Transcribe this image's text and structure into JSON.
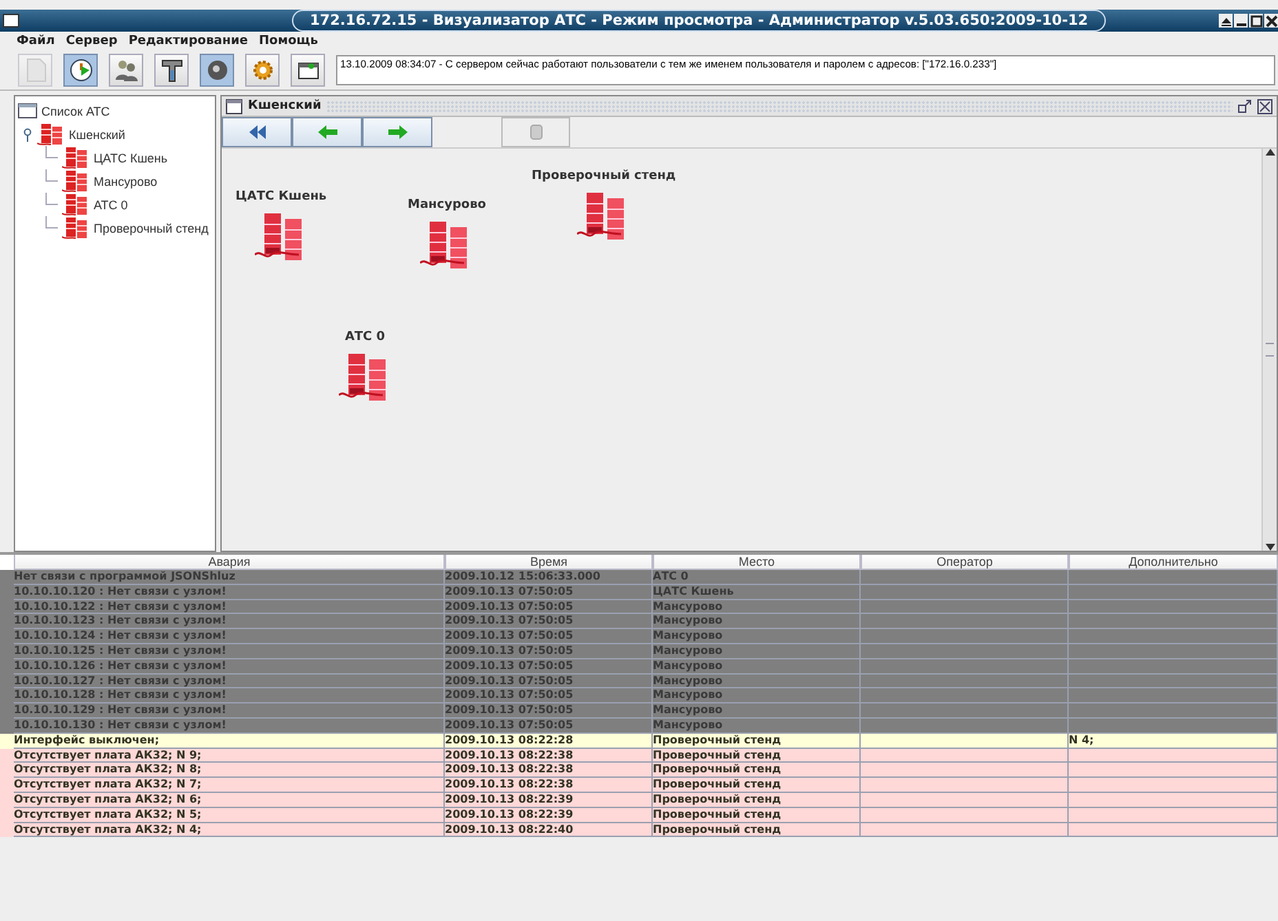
{
  "window": {
    "title": "172.16.72.15 - Визуализатор АТС - Режим просмотра - Администратор v.5.03.650:2009-10-12"
  },
  "menu": [
    "Файл",
    "Сервер",
    "Редактирование",
    "Помощь"
  ],
  "toolbar": [
    {
      "disabled": true,
      "pressed": false
    },
    {
      "disabled": false,
      "pressed": true
    },
    {
      "disabled": false,
      "pressed": false
    },
    {
      "disabled": false,
      "pressed": false
    },
    {
      "disabled": false,
      "pressed": true
    },
    {
      "disabled": false,
      "pressed": false
    },
    {
      "disabled": false,
      "pressed": false
    }
  ],
  "message": "13.10.2009 08:34:07 - С сервером сейчас работают пользователи с тем же именем пользователя и паролем с адресов: [\"172.16.0.233\"]",
  "tree": {
    "title": "Список АТС",
    "items": [
      {
        "label": "Кшенский",
        "expanded": true,
        "children": [
          {
            "label": "ЦАТС Кшень"
          },
          {
            "label": "Мансурово"
          },
          {
            "label": "АТС 0"
          },
          {
            "label": "Проверочный стенд"
          }
        ]
      }
    ]
  },
  "map": {
    "title": "Кшенский",
    "nodes": [
      {
        "label": "ЦАТС Кшень"
      },
      {
        "label": "Мансурово"
      },
      {
        "label": "Проверочный стенд"
      },
      {
        "label": "АТС 0"
      }
    ]
  },
  "alarms": {
    "columns": [
      "Авария",
      "Время",
      "Место",
      "Оператор",
      "Дополнительно"
    ],
    "rows": [
      {
        "kind": "lost",
        "cells": [
          "Нет связи с программой JSONShluz",
          "2009.10.12 15:06:33.000",
          "АТС 0",
          "",
          ""
        ]
      },
      {
        "kind": "lost",
        "cells": [
          "10.10.10.120 : Нет связи с узлом!",
          "2009.10.13 07:50:05",
          "ЦАТС Кшень",
          "",
          ""
        ]
      },
      {
        "kind": "lost",
        "cells": [
          "10.10.10.122 : Нет связи с узлом!",
          "2009.10.13 07:50:05",
          "Мансурово",
          "",
          ""
        ]
      },
      {
        "kind": "lost",
        "cells": [
          "10.10.10.123 : Нет связи с узлом!",
          "2009.10.13 07:50:05",
          "Мансурово",
          "",
          ""
        ]
      },
      {
        "kind": "lost",
        "cells": [
          "10.10.10.124 : Нет связи с узлом!",
          "2009.10.13 07:50:05",
          "Мансурово",
          "",
          ""
        ]
      },
      {
        "kind": "lost",
        "cells": [
          "10.10.10.125 : Нет связи с узлом!",
          "2009.10.13 07:50:05",
          "Мансурово",
          "",
          ""
        ]
      },
      {
        "kind": "lost",
        "cells": [
          "10.10.10.126 : Нет связи с узлом!",
          "2009.10.13 07:50:05",
          "Мансурово",
          "",
          ""
        ]
      },
      {
        "kind": "lost",
        "cells": [
          "10.10.10.127 : Нет связи с узлом!",
          "2009.10.13 07:50:05",
          "Мансурово",
          "",
          ""
        ]
      },
      {
        "kind": "lost",
        "cells": [
          "10.10.10.128 : Нет связи с узлом!",
          "2009.10.13 07:50:05",
          "Мансурово",
          "",
          ""
        ]
      },
      {
        "kind": "lost",
        "cells": [
          "10.10.10.129 : Нет связи с узлом!",
          "2009.10.13 07:50:05",
          "Мансурово",
          "",
          ""
        ]
      },
      {
        "kind": "lost",
        "cells": [
          "10.10.10.130 : Нет связи с узлом!",
          "2009.10.13 07:50:05",
          "Мансурово",
          "",
          ""
        ]
      },
      {
        "kind": "warning",
        "cells": [
          "Интерфейс выключен;",
          "2009.10.13 08:22:28",
          "Проверочный стенд",
          "",
          "N 4;"
        ]
      },
      {
        "kind": "alarm",
        "cells": [
          "Отсутствует плата АК32; N 9;",
          "2009.10.13 08:22:38",
          "Проверочный стенд",
          "",
          ""
        ]
      },
      {
        "kind": "alarm",
        "cells": [
          "Отсутствует плата АК32; N 8;",
          "2009.10.13 08:22:38",
          "Проверочный стенд",
          "",
          ""
        ]
      },
      {
        "kind": "alarm",
        "cells": [
          "Отсутствует плата АК32; N 7;",
          "2009.10.13 08:22:38",
          "Проверочный стенд",
          "",
          ""
        ]
      },
      {
        "kind": "alarm",
        "cells": [
          "Отсутствует плата АК32; N 6;",
          "2009.10.13 08:22:39",
          "Проверочный стенд",
          "",
          ""
        ]
      },
      {
        "kind": "alarm",
        "cells": [
          "Отсутствует плата АК32; N 5;",
          "2009.10.13 08:22:39",
          "Проверочный стенд",
          "",
          ""
        ]
      },
      {
        "kind": "alarm",
        "cells": [
          "Отсутствует плата АК32; N 4;",
          "2009.10.13 08:22:40",
          "Проверочный стенд",
          "",
          ""
        ]
      }
    ]
  }
}
